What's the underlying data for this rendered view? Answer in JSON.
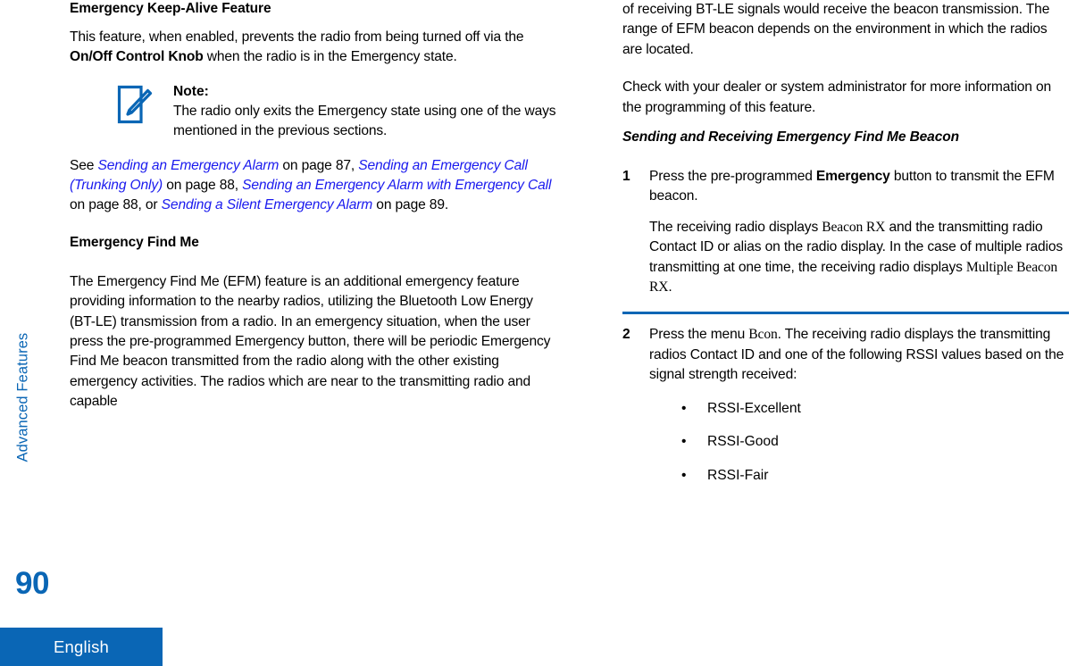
{
  "sidebar": {
    "chapter_label": "Advanced Features",
    "page_number": "90",
    "language_tab": "English",
    "accent_color": "#0a66b5"
  },
  "colors": {
    "accent_blue": "#0a66b5",
    "link_blue": "#1a1aee",
    "rule_blue": "#0a66b5"
  },
  "left_column": {
    "heading_1": "Emergency Keep-Alive Feature",
    "para_1": {
      "part_1": "This feature, when enabled, prevents the radio from being turned off via the ",
      "bold_1": "On/Off Control Knob",
      "part_2": " when the radio is in the Emergency state."
    },
    "note": {
      "icon": "note-pencil-icon",
      "title": "Note:",
      "body": "The radio only exits the Emergency state using one of the ways mentioned in the previous sections."
    },
    "see_also": {
      "lead": "See ",
      "link_1": "Sending an Emergency Alarm",
      "mid_1": " on page 87, ",
      "link_2": "Sending an Emergency Call (Trunking Only)",
      "mid_2": " on page 88, ",
      "link_3": "Sending an Emergency Alarm with Emergency Call",
      "mid_3": " on page 88, or ",
      "link_4": "Sending a Silent Emergency Alarm",
      "tail": " on page 89."
    },
    "heading_2": "Emergency Find Me",
    "para_2": "The Emergency Find Me (EFM) feature is an additional emergency feature providing information to the nearby radios, utilizing the Bluetooth Low Energy (BT-LE) transmission from a radio. In an emergency situation, when the user press the pre-programmed Emergency button, there will be periodic Emergency Find Me beacon transmitted from the radio along with the other existing emergency activities. The radios which are near to the transmitting radio and capable"
  },
  "right_column": {
    "para_continued": "of receiving BT-LE signals would receive the beacon transmission. The range of EFM beacon depends on the environment in which the radios are located.",
    "para_check": "Check with your dealer or system administrator for more information on the programming of this feature.",
    "subheading": "Sending and Receiving Emergency Find Me Beacon",
    "steps": [
      {
        "number": "1",
        "text_part_1": "Press the pre-programmed ",
        "bold_1": "Emergency",
        "text_part_2": " button to transmit the EFM beacon.",
        "follow_up": {
          "part_1": "The receiving radio displays ",
          "ui_1": "Beacon RX",
          "part_2": " and the transmitting radio Contact ID or alias on the radio display. In the case of multiple radios transmitting at one time, the receiving radio displays ",
          "ui_2": "Multiple Beacon RX",
          "part_3": "."
        }
      },
      {
        "number": "2",
        "text_part_1": "Press the menu ",
        "ui_1": "Bcon",
        "text_part_2": ". The receiving radio displays the transmitting radios Contact ID and one of the following RSSI values based on the signal strength received:",
        "bullets": [
          "RSSI-Excellent",
          "RSSI-Good",
          "RSSI-Fair"
        ]
      }
    ]
  }
}
